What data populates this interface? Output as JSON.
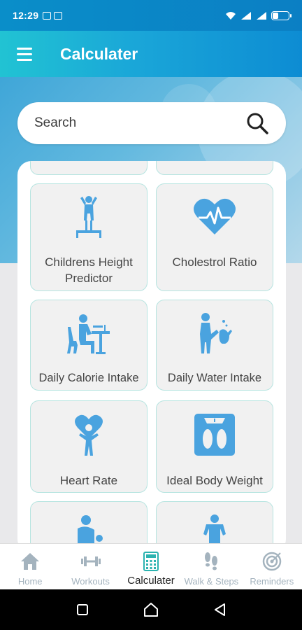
{
  "status_bar": {
    "time": "12:29"
  },
  "app_bar": {
    "title": "Calculater"
  },
  "search": {
    "placeholder": "Search"
  },
  "cards": [
    {
      "label": "Childrens Height\nPredictor",
      "icon": "child-height-icon"
    },
    {
      "label": "Cholestrol Ratio",
      "icon": "heart-pulse-icon"
    },
    {
      "label": "Daily Calorie Intake",
      "icon": "dining-person-icon"
    },
    {
      "label": "Daily Water Intake",
      "icon": "water-person-icon"
    },
    {
      "label": "Heart Rate",
      "icon": "heart-person-icon"
    },
    {
      "label": "Ideal Body Weight",
      "icon": "scale-icon"
    }
  ],
  "bottom_nav": [
    {
      "label": "Home",
      "icon": "home-icon"
    },
    {
      "label": "Workouts",
      "icon": "dumbbell-icon"
    },
    {
      "label": "Calculater",
      "icon": "calculator-icon",
      "active": true
    },
    {
      "label": "Walk & Steps",
      "icon": "footsteps-icon"
    },
    {
      "label": "Reminders",
      "icon": "target-icon"
    }
  ],
  "colors": {
    "accent": "#4aa3df",
    "nav_inactive": "#a4b3be",
    "card_border": "#b6e4e0"
  }
}
